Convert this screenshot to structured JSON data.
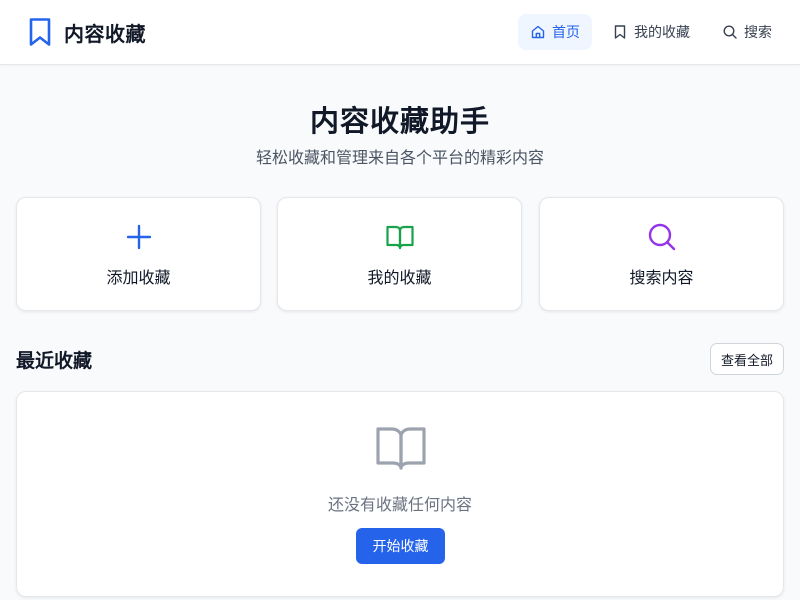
{
  "header": {
    "brand_title": "内容收藏",
    "brand_icon": "bookmark-icon",
    "nav": [
      {
        "label": "首页",
        "icon": "home-icon",
        "active": true
      },
      {
        "label": "我的收藏",
        "icon": "bookmark-icon",
        "active": false
      },
      {
        "label": "搜索",
        "icon": "search-icon",
        "active": false
      }
    ]
  },
  "hero": {
    "title": "内容收藏助手",
    "subtitle": "轻松收藏和管理来自各个平台的精彩内容"
  },
  "actions": [
    {
      "label": "添加收藏",
      "icon": "plus-icon",
      "color": "#2563eb"
    },
    {
      "label": "我的收藏",
      "icon": "book-open-icon",
      "color": "#16a34a"
    },
    {
      "label": "搜索内容",
      "icon": "search-icon",
      "color": "#9333ea"
    }
  ],
  "recent": {
    "title": "最近收藏",
    "view_all_label": "查看全部",
    "empty_icon": "book-open-icon",
    "empty_text": "还没有收藏任何内容",
    "start_label": "开始收藏"
  },
  "colors": {
    "accent": "#2563eb",
    "background": "#f8fafc"
  }
}
